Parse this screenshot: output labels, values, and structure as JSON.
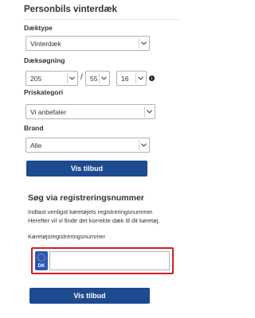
{
  "filter": {
    "title": "Personbils vinterdæk",
    "tire_type": {
      "label": "Dæktype",
      "value": "Vinterdæk"
    },
    "tire_search": {
      "label": "Dæksøgning",
      "width": "205",
      "separator": "/",
      "profile": "55",
      "rim": "16",
      "info_icon": "i"
    },
    "price_category": {
      "label": "Priskategori",
      "value": "Vi anbefaler"
    },
    "brand": {
      "label": "Brand",
      "value": "Alle"
    },
    "submit_label": "Vis tilbud"
  },
  "plate_search": {
    "title": "Søg via registreringsnummer",
    "help_line1": "Indtast venligst køretøjets registreringsnummer.",
    "help_line2": "Herefter vil vi finde det korrekte dæk til dit køretøj.",
    "field_label": "Køretøjsregistreringsnummer",
    "country_code": "DK",
    "input_value": "",
    "submit_label": "Vis tilbud"
  },
  "colors": {
    "button": "#1e4a8f",
    "highlight_border": "#d32020",
    "plate_badge": "#2b57b8"
  }
}
